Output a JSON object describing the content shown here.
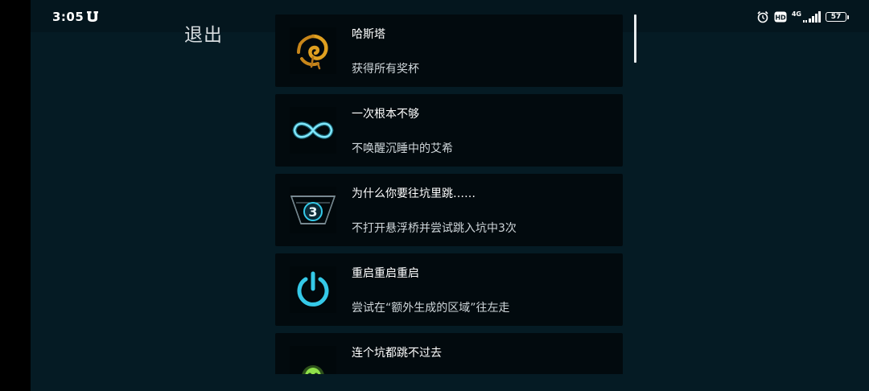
{
  "status_bar": {
    "time": "3:05",
    "network": "4G",
    "hd_label": "HD",
    "battery": "57"
  },
  "exit_label": "退出",
  "achievements": [
    {
      "title": "哈斯塔",
      "description": "获得所有奖杯",
      "icon": "hastur-sigil-icon"
    },
    {
      "title": "一次根本不够",
      "description": "不唤醒沉睡中的艾希",
      "icon": "infinity-icon"
    },
    {
      "title": "为什么你要往坑里跳……",
      "description": "不打开悬浮桥并尝试跳入坑中3次",
      "icon": "pit-three-icon",
      "icon_number": "3"
    },
    {
      "title": "重启重启重启",
      "description": "尝试在“额外生成的区域”往左走",
      "icon": "power-icon"
    },
    {
      "title": "连个坑都跳不过去",
      "description": "",
      "icon": "green-skull-icon"
    }
  ],
  "colors": {
    "background": "#051b24",
    "card": "#020a0e",
    "accent_cyan": "#35c9e8",
    "accent_gold": "#e0a020",
    "accent_green": "#7ed63a"
  }
}
